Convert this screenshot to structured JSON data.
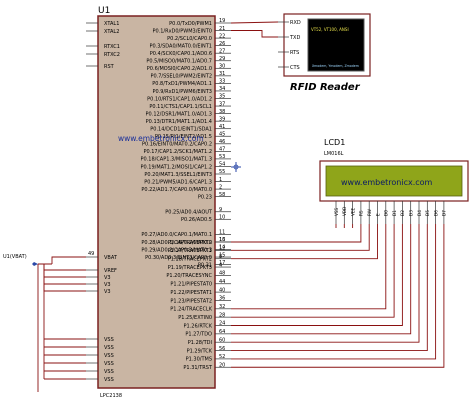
{
  "mcu": {
    "ref": "U1",
    "part": "LPC2138",
    "left_pins": [
      "XTAL1",
      "XTAL2",
      "",
      "RTXC1",
      "RTXC2",
      "",
      "RST"
    ],
    "left_pins_lower": [
      "VBAT",
      "",
      "VREF",
      "V3",
      "V3",
      "V3",
      "",
      "VSS",
      "VSS",
      "VSS",
      "VSS",
      "VSS",
      "VSS"
    ],
    "left_pin_nums": [
      "49",
      "",
      "",
      "",
      "",
      "",
      ""
    ],
    "right_pins": [
      "P0.0/TxD0/PWM1",
      "P0.1/RxD0/PWM3/EINT0",
      "P0.2/SCL0/CAP0.0",
      "P0.3/SDA0/MAT0.0/EINT1",
      "P0.4/SCK0/CAP0.1/AD0.6",
      "P0.5/MISO0/MAT0.1/AD0.7",
      "P0.6/MOSI0/CAP0.2/AD1.0",
      "P0.7/SSEL0/PWM2/EINT2",
      "P0.8/TxD1/PWM4/AD1.1",
      "P0.9/RxD1/PWM6/EINT3",
      "P0.10/RTS1/CAP1.0/AD1.2",
      "P0.11/CTS1/CAP1.1/SCL1",
      "P0.12/DSR1/MAT1.0/AD1.3",
      "P0.13/DTR1/MAT1.1/AD1.4",
      "P0.14/DCD1/EINT1/SDA1",
      "P0.15/RI1/EINT2/AD1.5",
      "P0.16/EINT0/MAT0.2/CAP0.2",
      "P0.17/CAP1.2/SCK1/MAT1.2",
      "P0.18/CAP1.3/MISO1/MAT1.3",
      "P0.19/MAT1.2/MOSI1/CAP1.2",
      "P0.20/MAT1.3/SSEL1/EINT3",
      "P0.21/PWM5/AD1.6/CAP1.3",
      "P0.22/AD1.7/CAP0.0/MAT0.0",
      "P0.23",
      "",
      "P0.25/AD0.4/AOUT",
      "P0.26/AD0.5",
      "",
      "P0.27/AD0.0/CAP0.1/MAT0.1",
      "P0.28/AD0.1/CAP0.2/MAT0.2",
      "P0.29/AD0.2/CAP0.3/MAT0.3",
      "P0.30/AD0.3/EINT3/CAP0.0",
      "P0.31"
    ],
    "right_pins_lower": [
      "P1.16/TRACEPKT0",
      "P1.17/TRACEPKT1",
      "P1.18/TRACEPKT2",
      "P1.19/TRACEPKT3",
      "P1.20/TRACESYNC",
      "P1.21/PIPESTAT0",
      "P1.22/PIPESTAT1",
      "P1.23/PIPESTAT2",
      "P1.24/TRACECLK",
      "P1.25/EXTIN0",
      "P1.26/RTCK",
      "P1.27/TDO",
      "P1.28/TDI",
      "P1.29/TCK",
      "P1.30/TMS",
      "P1.31/TRST"
    ],
    "right_pin_nums": [
      "19",
      "21",
      "22",
      "26",
      "27",
      "29",
      "30",
      "31",
      "33",
      "34",
      "35",
      "37",
      "38",
      "39",
      "41",
      "45",
      "46",
      "47",
      "53",
      "54",
      "55",
      "1",
      "2",
      "58",
      "",
      "9",
      "10",
      "",
      "11",
      "13",
      "14",
      "15",
      "17"
    ],
    "right_pin_nums_lower": [
      "16",
      "12",
      "8",
      "4",
      "48",
      "44",
      "40",
      "36",
      "32",
      "28",
      "24",
      "64",
      "60",
      "56",
      "52",
      "20"
    ]
  },
  "rfid": {
    "title": "RFID Reader",
    "screen_text": "VT52, VT100, ANSI",
    "screen_subtext": "Xmodem, Ymodem, Zmodem",
    "pins": [
      "RXD",
      "TXD",
      "RTS",
      "CTS"
    ]
  },
  "lcd": {
    "ref": "LCD1",
    "part": "LM016L",
    "display_text": "www.embetronicx.com",
    "pins": [
      "VSS",
      "VDD",
      "VEE",
      "RS",
      "RW",
      "E",
      "D0",
      "D1",
      "D2",
      "D3",
      "D4",
      "D5",
      "D6",
      "D7"
    ]
  },
  "power": {
    "label": "U1(VBAT)"
  },
  "watermark": "www.embetronicx.com",
  "colors": {
    "wire": "#8a1010",
    "chip_fill": "#c9b5a3",
    "lcd_green": "#8fa51a",
    "lcd_text": "#0a1a66",
    "term_bg": "#000000",
    "term_text": "#e8e14a",
    "connector": "#2c4aa8"
  }
}
